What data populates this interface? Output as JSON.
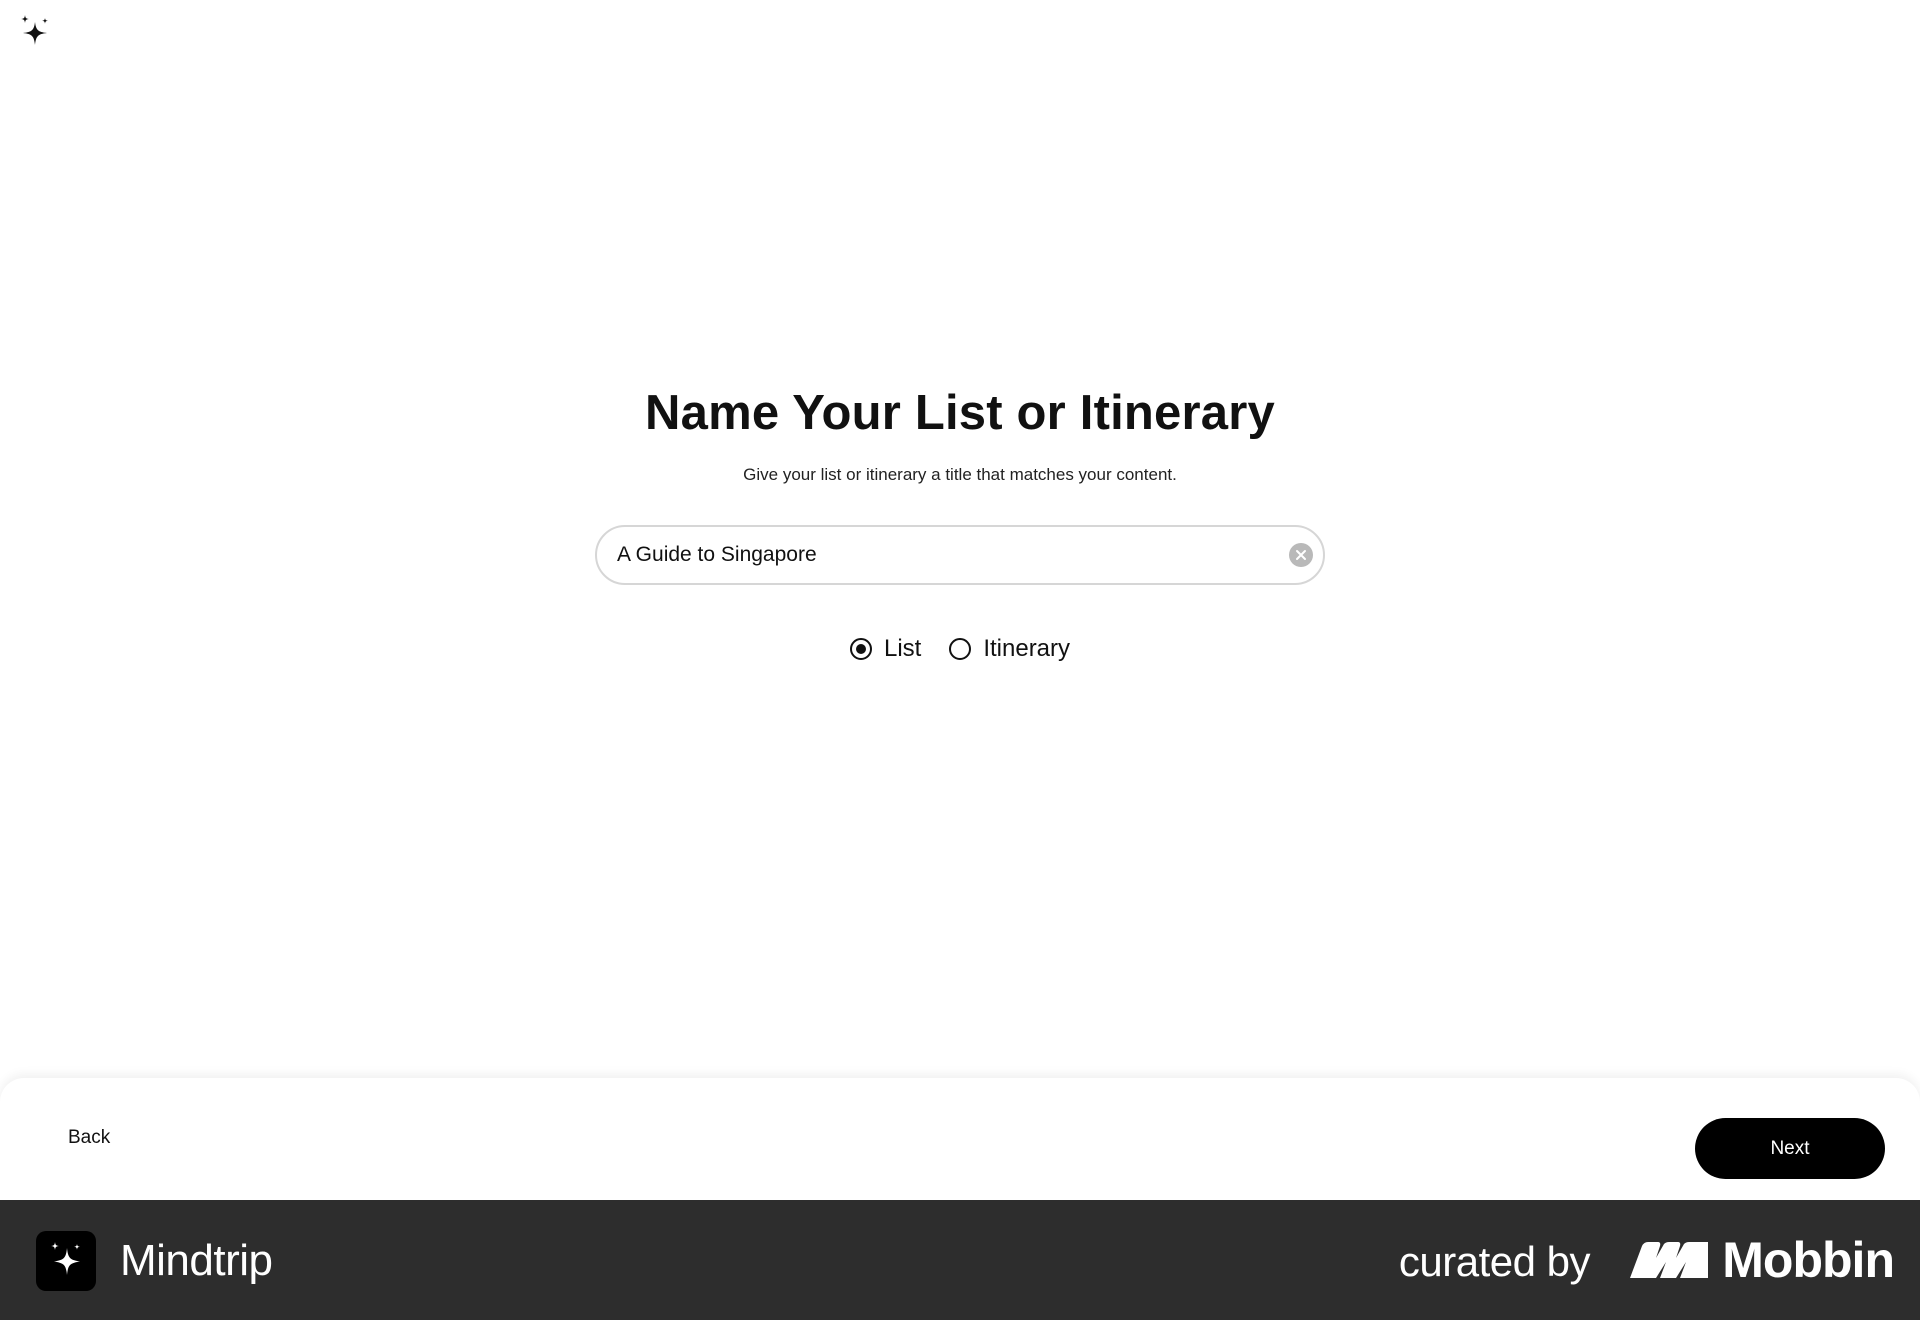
{
  "header": {
    "logo_icon": "sparkle-icon"
  },
  "main": {
    "title": "Name Your List or Itinerary",
    "subtitle": "Give your list or itinerary a title that matches your content.",
    "title_input": {
      "value": "A Guide to Singapore",
      "clear_icon": "clear-circle-icon"
    },
    "type_options": [
      {
        "label": "List",
        "checked": true
      },
      {
        "label": "Itinerary",
        "checked": false
      }
    ]
  },
  "bottom_bar": {
    "back_label": "Back",
    "next_label": "Next"
  },
  "footer": {
    "app_icon": "sparkle-icon",
    "app_name": "Mindtrip",
    "curated_label": "curated by",
    "brand_name": "Mobbin",
    "brand_icon": "mobbin-logo-icon"
  },
  "colors": {
    "primary": "#000000",
    "footer_bg": "#2d2d2d",
    "input_border": "#d6d6d6",
    "clear_button": "#b9b9b9"
  }
}
